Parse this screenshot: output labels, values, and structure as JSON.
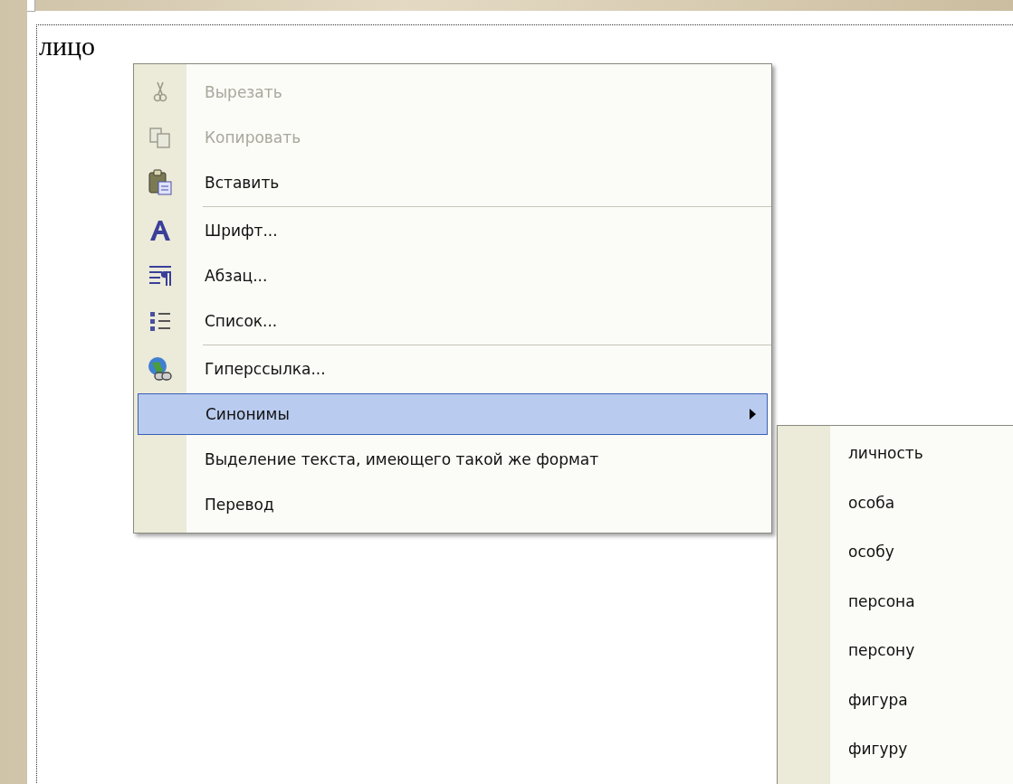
{
  "document": {
    "text": "лицо"
  },
  "context_menu": {
    "items": [
      {
        "kind": "item",
        "label": "Вырезать",
        "disabled": true,
        "selected": false,
        "has_submenu": false
      },
      {
        "kind": "item",
        "label": "Копировать",
        "disabled": true,
        "selected": false,
        "has_submenu": false
      },
      {
        "kind": "item",
        "label": "Вставить",
        "disabled": false,
        "selected": false,
        "has_submenu": false
      },
      {
        "kind": "separator"
      },
      {
        "kind": "item",
        "label": "Шрифт...",
        "disabled": false,
        "selected": false,
        "has_submenu": false
      },
      {
        "kind": "item",
        "label": "Абзац...",
        "disabled": false,
        "selected": false,
        "has_submenu": false
      },
      {
        "kind": "item",
        "label": "Список...",
        "disabled": false,
        "selected": false,
        "has_submenu": false
      },
      {
        "kind": "separator"
      },
      {
        "kind": "item",
        "label": "Гиперссылка...",
        "disabled": false,
        "selected": false,
        "has_submenu": false
      },
      {
        "kind": "item",
        "label": "Синонимы",
        "disabled": false,
        "selected": true,
        "has_submenu": true
      },
      {
        "kind": "item",
        "label": "Выделение текста, имеющего такой же формат",
        "disabled": false,
        "selected": false,
        "has_submenu": false
      },
      {
        "kind": "item",
        "label": "Перевод",
        "disabled": false,
        "selected": false,
        "has_submenu": false
      }
    ]
  },
  "submenu": {
    "items": [
      {
        "kind": "item",
        "label": "личность",
        "disabled": false,
        "selected": false,
        "has_submenu": false
      },
      {
        "kind": "item",
        "label": "особа",
        "disabled": false,
        "selected": false,
        "has_submenu": false
      },
      {
        "kind": "item",
        "label": "особу",
        "disabled": false,
        "selected": false,
        "has_submenu": false
      },
      {
        "kind": "item",
        "label": "персона",
        "disabled": false,
        "selected": false,
        "has_submenu": false
      },
      {
        "kind": "item",
        "label": "персону",
        "disabled": false,
        "selected": false,
        "has_submenu": false
      },
      {
        "kind": "item",
        "label": "фигура",
        "disabled": false,
        "selected": false,
        "has_submenu": false
      },
      {
        "kind": "item",
        "label": "фигуру",
        "disabled": false,
        "selected": false,
        "has_submenu": false
      }
    ]
  }
}
